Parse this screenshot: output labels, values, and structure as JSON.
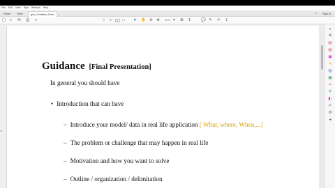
{
  "menu": [
    "File",
    "Edit",
    "View",
    "Sign",
    "Window",
    "Help"
  ],
  "tabs": {
    "home": "Home",
    "tools": "Tools",
    "document": "gdn_Guideline_Final...",
    "close": "×"
  },
  "header": {
    "help": "?",
    "sign_in": "Sign In"
  },
  "toolbar": {
    "page_current": "1",
    "page_sep": "/ 1",
    "zoom": "49%",
    "icons": [
      "save-icon",
      "star-icon",
      "email-icon",
      "print-icon",
      "search-icon",
      "prev-page-icon",
      "next-page-icon",
      "select-icon",
      "hand-icon",
      "zoom-out-icon",
      "zoom-in-icon",
      "zoom-dropdown-icon",
      "fit-icon",
      "scroll-mode-icon",
      "comment-icon",
      "highlight-icon",
      "sign-icon",
      "share-icon"
    ]
  },
  "colors": {
    "accent": "#3b6fc4",
    "highlight_text": "#d8a000"
  },
  "right_pane_icons": [
    "search-icon",
    "zoom-in-icon",
    "export-pdf-icon",
    "create-pdf-icon",
    "edit-pdf-icon",
    "comment-icon",
    "combine-icon",
    "organize-icon",
    "redact-icon",
    "protect-icon",
    "optimize-icon",
    "fill-sign-icon",
    "more-tools-icon",
    "expand-icon"
  ],
  "doc": {
    "title": "Guidance",
    "subtitle": "[Final Presentation]",
    "intro": "In general you should have",
    "bullet": "Introduction that can have",
    "bullet_dot": "•",
    "dash": "–",
    "sub1_text": "Introduce your model/ data in real life application",
    "sub1_highlight": "[ What, where, When,...]",
    "sub2": "The problem or challenge that may happen in real life",
    "sub3": "Motivation and how you want to solve",
    "sub4": "Outline / organization / delimitation"
  }
}
